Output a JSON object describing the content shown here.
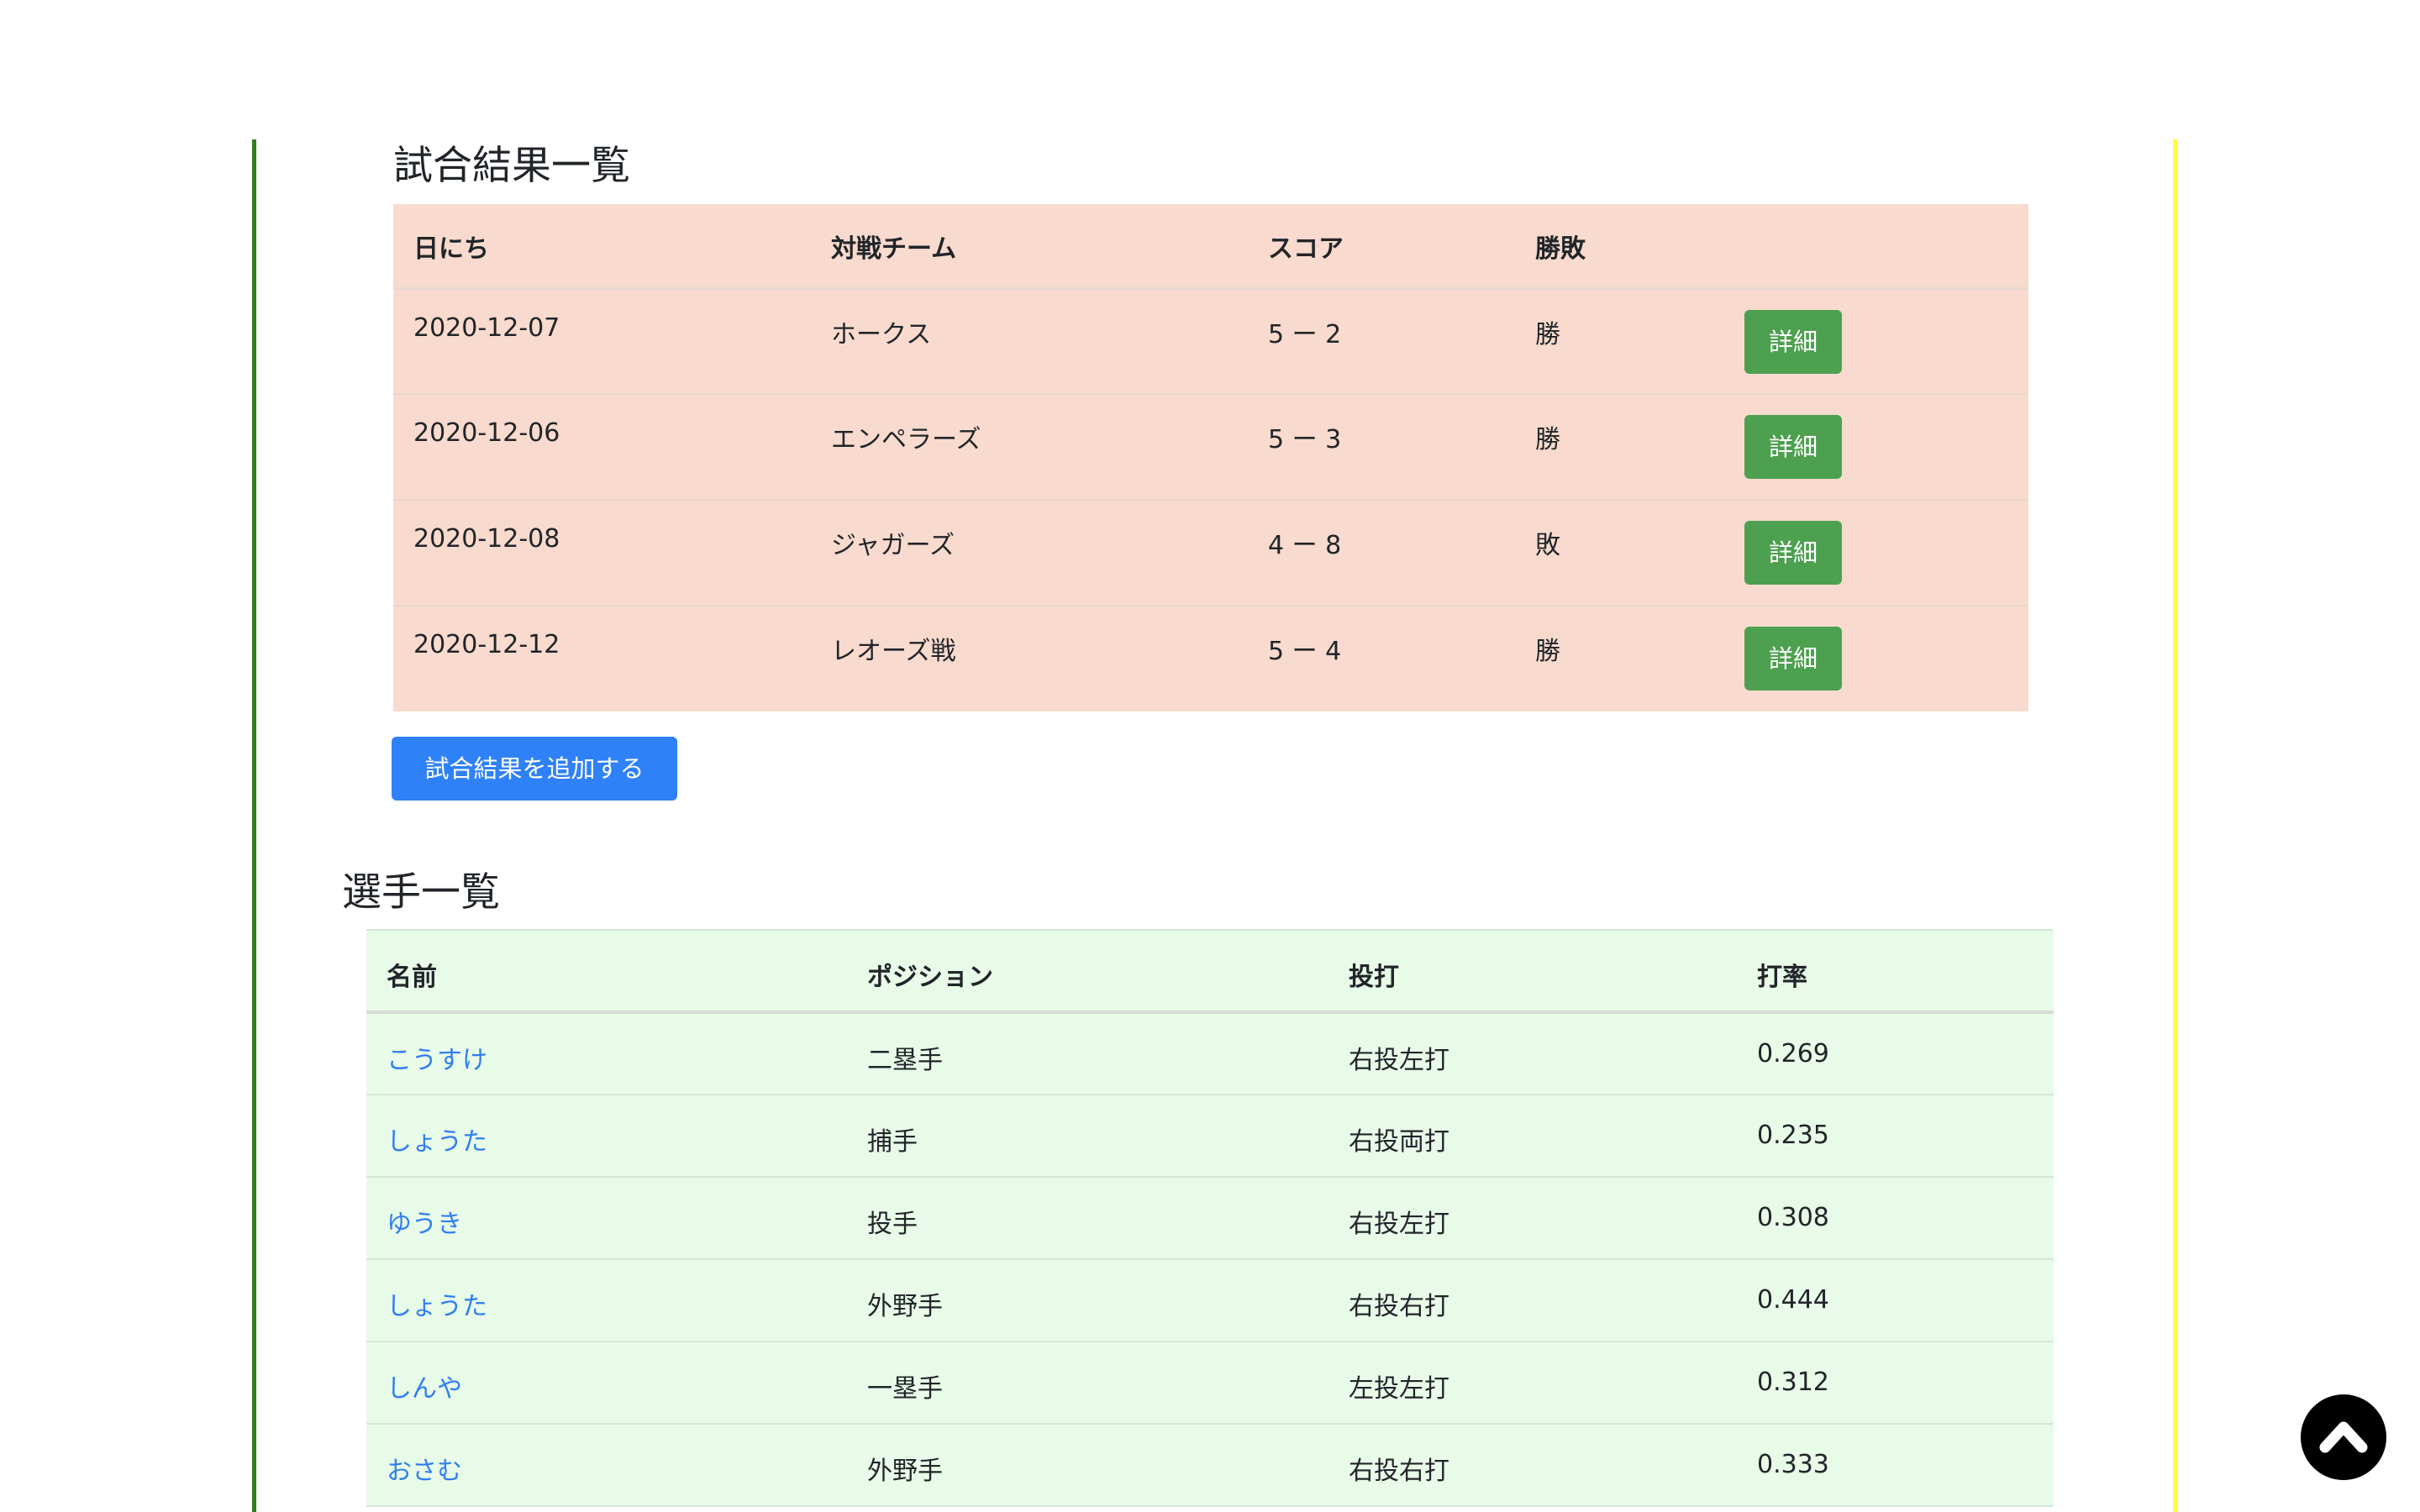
{
  "games": {
    "title": "試合結果一覧",
    "headers": [
      "日にち",
      "対戦チーム",
      "スコア",
      "勝敗"
    ],
    "rows": [
      {
        "date": "2020-12-07",
        "opponent": "ホークス",
        "score": "5 ー 2",
        "result": "勝",
        "button": "詳細"
      },
      {
        "date": "2020-12-06",
        "opponent": "エンペラーズ",
        "score": "5 ー 3",
        "result": "勝",
        "button": "詳細"
      },
      {
        "date": "2020-12-08",
        "opponent": "ジャガーズ",
        "score": "4 ー 8",
        "result": "敗",
        "button": "詳細"
      },
      {
        "date": "2020-12-12",
        "opponent": "レオーズ戦",
        "score": "5 ー 4",
        "result": "勝",
        "button": "詳細"
      }
    ],
    "add_button": "試合結果を追加する"
  },
  "players": {
    "title": "選手一覧",
    "headers": [
      "名前",
      "ポジション",
      "投打",
      "打率"
    ],
    "rows": [
      {
        "name": "こうすけ",
        "position": "二塁手",
        "throw_bat": "右投左打",
        "avg": "0.269"
      },
      {
        "name": "しょうた",
        "position": "捕手",
        "throw_bat": "右投両打",
        "avg": "0.235"
      },
      {
        "name": "ゆうき",
        "position": "投手",
        "throw_bat": "右投左打",
        "avg": "0.308"
      },
      {
        "name": "しょうた",
        "position": "外野手",
        "throw_bat": "右投右打",
        "avg": "0.444"
      },
      {
        "name": "しんや",
        "position": "一塁手",
        "throw_bat": "左投左打",
        "avg": "0.312"
      },
      {
        "name": "おさむ",
        "position": "外野手",
        "throw_bat": "右投右打",
        "avg": "0.333"
      }
    ]
  },
  "colors": {
    "left_border": "#2f7d1f",
    "right_border": "#ffff3d",
    "games_bg": "#f8dbce",
    "players_bg": "#e8fbe8",
    "detail_button": "#4da04f",
    "add_button": "#2f81f7",
    "link": "#2f7ef2"
  },
  "icons": {
    "scroll_top": "chevron-up-icon"
  }
}
